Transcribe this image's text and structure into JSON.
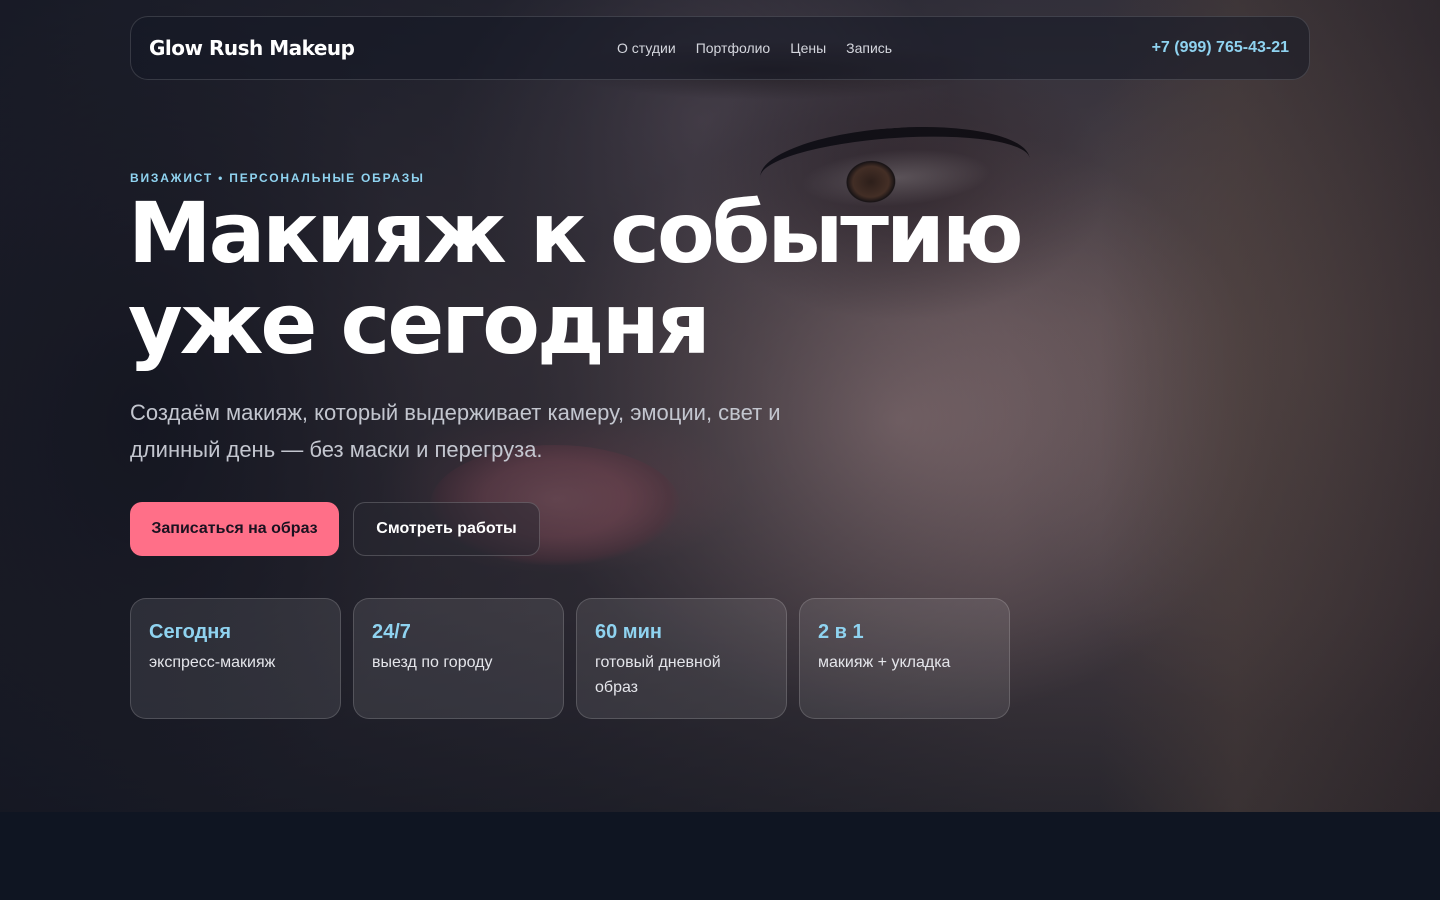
{
  "brand": {
    "name": "Glow Rush Makeup",
    "accent": "#8fd3f0",
    "cta": "#ff6f88"
  },
  "nav": {
    "items": [
      "О студии",
      "Портфолио",
      "Цены",
      "Запись"
    ],
    "phone": "+7 (999) 765-43-21"
  },
  "hero": {
    "eyebrow": "ВИЗАЖИСТ • ПЕРСОНАЛЬНЫЕ ОБРАЗЫ",
    "headline_line1": "Макияж к событию",
    "headline_line2": "уже сегодня",
    "lead": "Создаём макияж, который выдерживает камеру, эмоции, свет и длинный день — без маски и перегруза.",
    "primary_button": "Записаться на образ",
    "secondary_button": "Смотреть работы"
  },
  "stats": [
    {
      "value": "Сегодня",
      "label": "экспресс-макияж"
    },
    {
      "value": "24/7",
      "label": "выезд по городу"
    },
    {
      "value": "60 мин",
      "label": "готовый дневной образ"
    },
    {
      "value": "2 в 1",
      "label": "макияж + укладка"
    }
  ]
}
